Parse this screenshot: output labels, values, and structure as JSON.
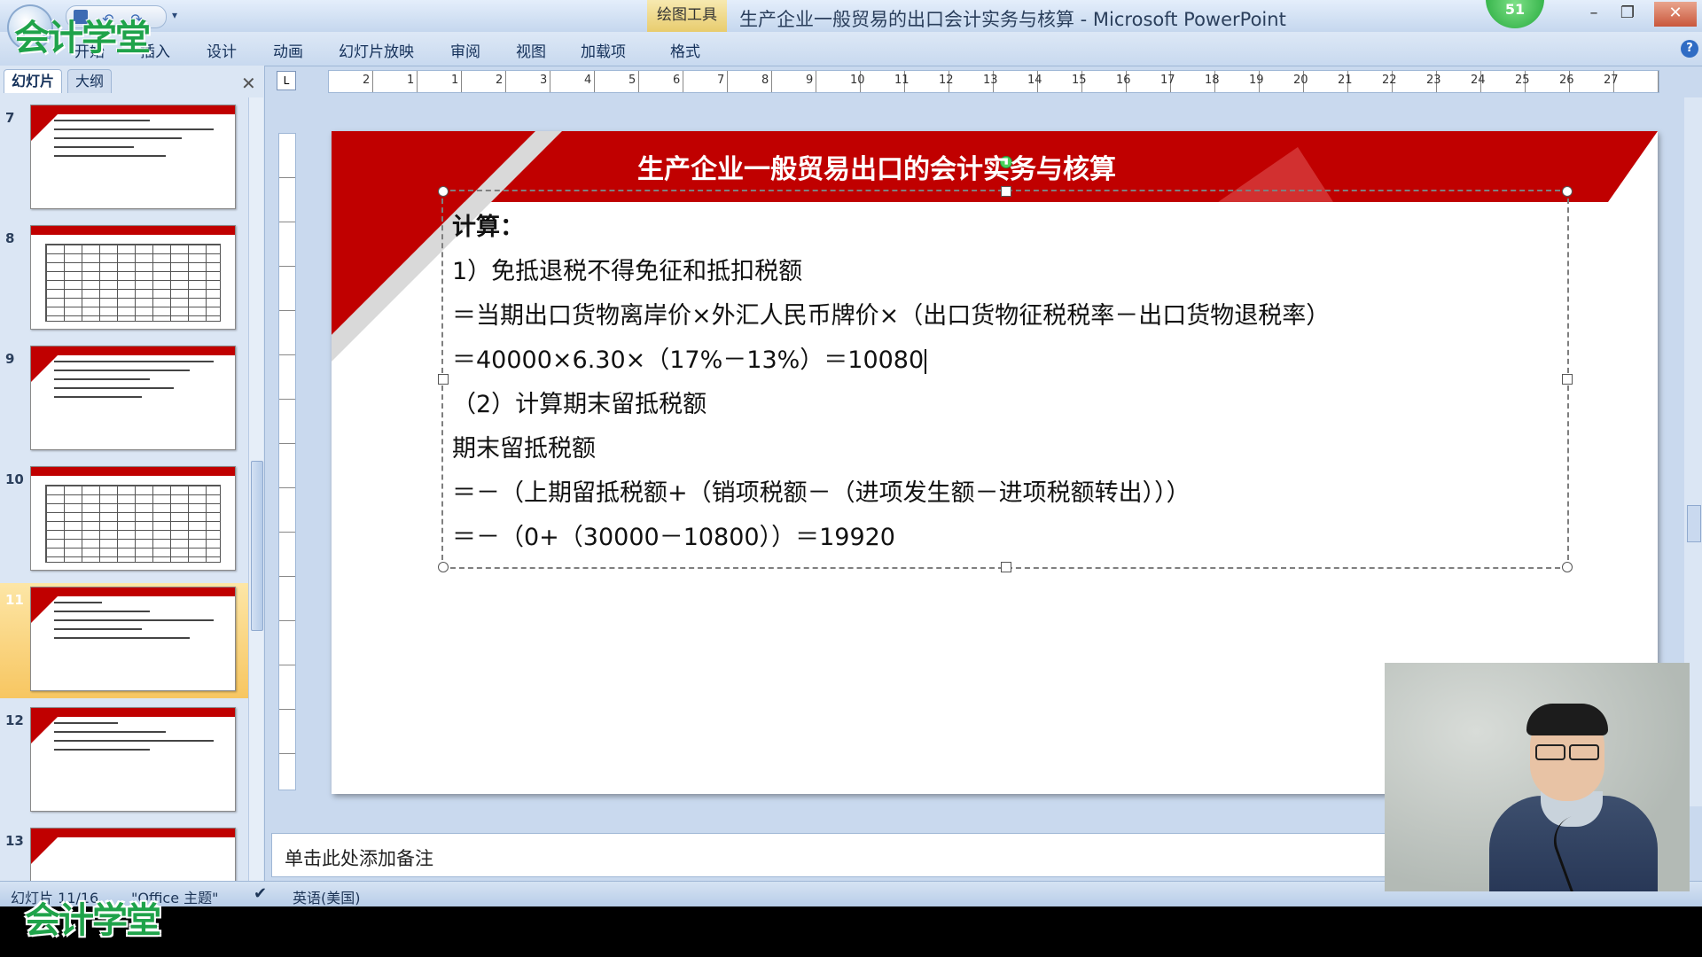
{
  "window": {
    "title": "生产企业一般贸易的出口会计实务与核算 - Microsoft PowerPoint",
    "context_tab": "绘图工具",
    "badge": "51",
    "logo": "会计学堂",
    "min": "–",
    "max": "❐",
    "close": "✕",
    "qat_more": "▾",
    "help": "?"
  },
  "ribbon": {
    "tabs": [
      "开始",
      "插入",
      "设计",
      "动画",
      "幻灯片放映",
      "审阅",
      "视图",
      "加载项",
      "格式"
    ]
  },
  "pane": {
    "tabs": [
      "幻灯片",
      "大纲"
    ],
    "close": "✕",
    "thumbnails": [
      {
        "number": "7",
        "kind": "text"
      },
      {
        "number": "8",
        "kind": "table"
      },
      {
        "number": "9",
        "kind": "text"
      },
      {
        "number": "10",
        "kind": "table"
      },
      {
        "number": "11",
        "kind": "text",
        "selected": true
      },
      {
        "number": "12",
        "kind": "text"
      },
      {
        "number": "13",
        "kind": "text"
      }
    ],
    "watermark": "会计学堂"
  },
  "ruler": {
    "corner": "L",
    "labels": [
      "2",
      "1",
      "1",
      "2",
      "3",
      "4",
      "5",
      "6",
      "7",
      "8",
      "9",
      "10",
      "11",
      "12",
      "13",
      "14",
      "15",
      "16",
      "17",
      "18",
      "19",
      "20",
      "21",
      "22",
      "23",
      "24",
      "25",
      "26",
      "27"
    ]
  },
  "slide": {
    "title": "生产企业一般贸易出口的会计实务与核算",
    "lines": [
      "计算：",
      "1）免抵退税不得免征和抵扣税额",
      "＝当期出口货物离岸价×外汇人民币牌价×（出口货物征税税率－出口货物退税率）",
      "＝40000×6.30×（17%－13%）＝10080",
      "（2）计算期末留抵税额",
      "期末留抵税额",
      "＝－（上期留抵税额+（销项税额－（进项发生额－进项税额转出）））",
      "＝－（0+（30000－10800））＝19920"
    ],
    "accent_color": "#c00000"
  },
  "notes": {
    "placeholder": "单击此处添加备注"
  },
  "status": {
    "slide_counter": "幻灯片 11/16",
    "theme": "\"Office 主题\"",
    "language": "英语(美国)"
  }
}
